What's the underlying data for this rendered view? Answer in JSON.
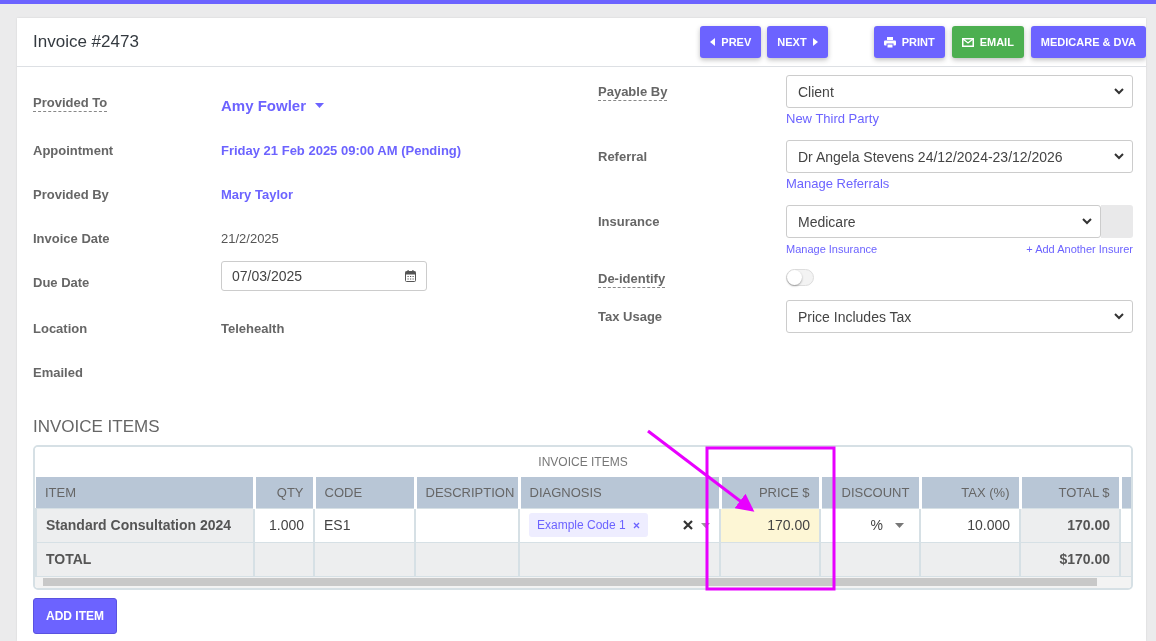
{
  "header": {
    "title": "Invoice #2473",
    "nav_buttons": [
      {
        "label": "PREV",
        "kind": "prev"
      },
      {
        "label": "NEXT",
        "kind": "next"
      }
    ],
    "action_buttons": [
      {
        "label": "PRINT",
        "kind": "print"
      },
      {
        "label": "EMAIL",
        "kind": "email"
      },
      {
        "label": "MEDICARE & DVA",
        "kind": "plain"
      }
    ]
  },
  "left_fields": [
    {
      "label": "Provided To",
      "has_help": true,
      "kind": "dropdown-link",
      "value": "Amy Fowler"
    },
    {
      "label": "Appointment",
      "has_help": false,
      "kind": "link",
      "value": "Friday 21 Feb 2025 09:00 AM (Pending)"
    },
    {
      "label": "Provided By",
      "has_help": false,
      "kind": "link",
      "value": "Mary Taylor"
    },
    {
      "label": "Invoice Date",
      "has_help": false,
      "kind": "text",
      "value": "21/2/2025"
    },
    {
      "label": "Due Date",
      "has_help": false,
      "kind": "date",
      "value": "07/03/2025"
    },
    {
      "label": "Location",
      "has_help": false,
      "kind": "text",
      "value": "Telehealth"
    },
    {
      "label": "Emailed",
      "has_help": false,
      "kind": "empty"
    }
  ],
  "right_fields": [
    {
      "label": "Payable By",
      "has_help": true,
      "kind": "select",
      "value": "Client",
      "links": [
        "New Third Party"
      ]
    },
    {
      "label": "Referral",
      "has_help": false,
      "kind": "select",
      "value": "Dr Angela Stevens 24/12/2024-23/12/2026",
      "links": [
        "Manage Referrals"
      ]
    },
    {
      "label": "Insurance",
      "has_help": false,
      "kind": "select-addon",
      "value": "Medicare",
      "links": [
        "Manage Insurance",
        "+ Add Another Insurer"
      ]
    },
    {
      "label": "De-identify",
      "has_help": true,
      "kind": "toggle",
      "on": false
    },
    {
      "label": "Tax Usage",
      "has_help": false,
      "kind": "select",
      "value": "Price Includes Tax"
    }
  ],
  "items_section": {
    "title": "INVOICE ITEMS",
    "add_button": "ADD ITEM"
  },
  "table": {
    "caption": "INVOICE ITEMS",
    "columns": [
      {
        "label": "ITEM",
        "kind": "text"
      },
      {
        "label": "QTY",
        "kind": "number"
      },
      {
        "label": "CODE",
        "kind": "text"
      },
      {
        "label": "DESCRIPTION",
        "kind": "text"
      },
      {
        "label": "DIAGNOSIS",
        "kind": "text"
      },
      {
        "label": "PRICE $",
        "kind": "number"
      },
      {
        "label": "DISCOUNT",
        "kind": "text"
      },
      {
        "label": "TAX (%)",
        "kind": "number"
      },
      {
        "label": "TOTAL $",
        "kind": "number"
      }
    ],
    "rows": [
      {
        "item": "Standard Consultation 2024",
        "qty": "1.000",
        "code": "ES1",
        "diagnosis": [
          {
            "label": "Example Code 1"
          }
        ],
        "price": "170.00",
        "price_focused": true,
        "discount": "%",
        "tax": "10.000",
        "total": "170.00"
      }
    ],
    "footer": {
      "label": "TOTAL",
      "total": "$170.00"
    }
  }
}
